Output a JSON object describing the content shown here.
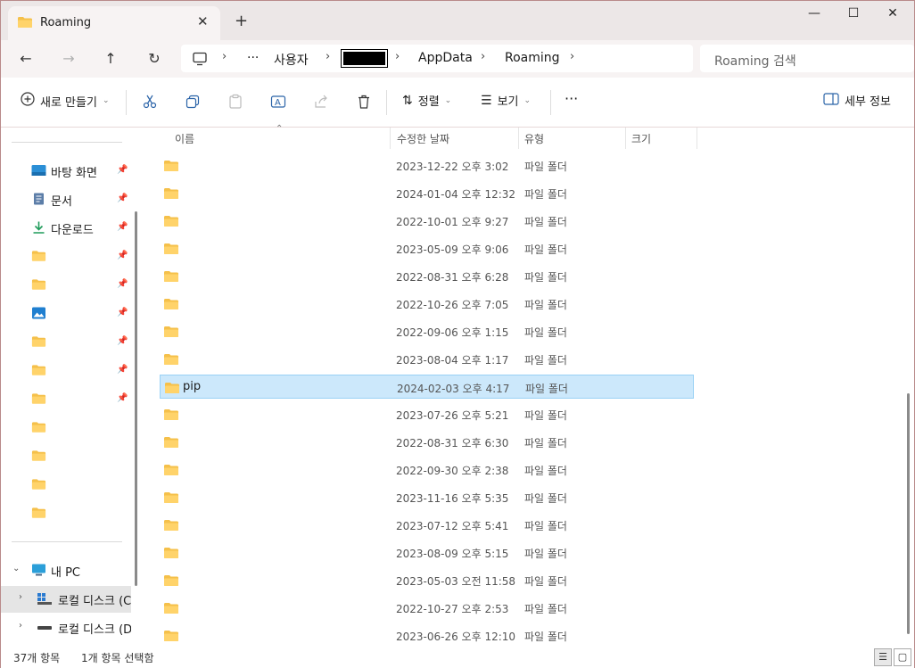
{
  "tab": {
    "title": "Roaming",
    "close": "✕",
    "new": "+"
  },
  "window_controls": {
    "minimize": "—",
    "maximize": "☐",
    "close": "✕"
  },
  "nav": {
    "back": "←",
    "forward": "→",
    "up": "↑",
    "refresh": "↻"
  },
  "breadcrumb": {
    "more": "···",
    "items": [
      "사용자",
      "AppData",
      "Roaming"
    ],
    "sep": "›"
  },
  "search": {
    "placeholder": "Roaming 검색"
  },
  "commands": {
    "new": "새로 만들기",
    "sort": "정렬",
    "view": "보기",
    "more": "···",
    "details": "세부 정보"
  },
  "sidebar": {
    "items": [
      {
        "label": "바탕 화면",
        "icon": "desktop-icon"
      },
      {
        "label": "문서",
        "icon": "document-icon"
      },
      {
        "label": "다운로드",
        "icon": "download-icon"
      }
    ],
    "this_pc": "내 PC",
    "drives": [
      "로컬 디스크 (C",
      "로컬 디스크 (D"
    ]
  },
  "columns": {
    "name": "이름",
    "modified": "수정한 날짜",
    "type": "유형",
    "size": "크기"
  },
  "rows": [
    {
      "name": "",
      "date": "2023-12-22 오후 3:02",
      "type": "파일 폴더"
    },
    {
      "name": "",
      "date": "2024-01-04 오후 12:32",
      "type": "파일 폴더"
    },
    {
      "name": "",
      "date": "2022-10-01 오후 9:27",
      "type": "파일 폴더"
    },
    {
      "name": "",
      "date": "2023-05-09 오후 9:06",
      "type": "파일 폴더"
    },
    {
      "name": "",
      "date": "2022-08-31 오후 6:28",
      "type": "파일 폴더"
    },
    {
      "name": "",
      "date": "2022-10-26 오후 7:05",
      "type": "파일 폴더"
    },
    {
      "name": "",
      "date": "2022-09-06 오후 1:15",
      "type": "파일 폴더"
    },
    {
      "name": "",
      "date": "2023-08-04 오후 1:17",
      "type": "파일 폴더"
    },
    {
      "name": "pip",
      "date": "2024-02-03 오후 4:17",
      "type": "파일 폴더",
      "selected": true
    },
    {
      "name": "",
      "date": "2023-07-26 오후 5:21",
      "type": "파일 폴더"
    },
    {
      "name": "",
      "date": "2022-08-31 오후 6:30",
      "type": "파일 폴더"
    },
    {
      "name": "",
      "date": "2022-09-30 오후 2:38",
      "type": "파일 폴더"
    },
    {
      "name": "",
      "date": "2023-11-16 오후 5:35",
      "type": "파일 폴더"
    },
    {
      "name": "",
      "date": "2023-07-12 오후 5:41",
      "type": "파일 폴더"
    },
    {
      "name": "",
      "date": "2023-08-09 오후 5:15",
      "type": "파일 폴더"
    },
    {
      "name": "",
      "date": "2023-05-03 오전 11:58",
      "type": "파일 폴더"
    },
    {
      "name": "",
      "date": "2022-10-27 오후 2:53",
      "type": "파일 폴더"
    },
    {
      "name": "",
      "date": "2023-06-26 오후 12:10",
      "type": "파일 폴더"
    }
  ],
  "status": {
    "count": "37개 항목",
    "selected": "1개 항목 선택함"
  },
  "colors": {
    "accent": "#0067c0",
    "folder": "#f5c04a",
    "selection": "#cce8fb"
  }
}
